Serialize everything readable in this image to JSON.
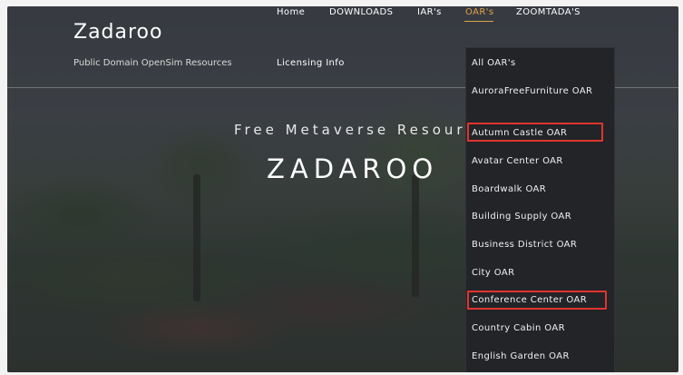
{
  "site": {
    "logo": "Zadaroo",
    "tagline": "Public Domain OpenSim Resources"
  },
  "nav": {
    "items": [
      "Home",
      "DOWNLOADS",
      "IAR's",
      "OAR's",
      "ZOOMTADA'S"
    ],
    "active": "OAR's",
    "second_row": "Licensing Info"
  },
  "hero": {
    "subtitle": "Free Metaverse Resources",
    "title": "ZADAROO"
  },
  "dropdown": {
    "items": [
      "All OAR's",
      "AuroraFreeFurniture OAR",
      "Autumn Castle OAR",
      "Avatar Center OAR",
      "Boardwalk OAR",
      "Building Supply OAR",
      "Business District OAR",
      "City OAR",
      "Conference Center OAR",
      "Country Cabin OAR",
      "English Garden OAR"
    ],
    "highlighted": [
      "Autumn Castle OAR",
      "Conference Center OAR"
    ]
  },
  "colors": {
    "accent": "#e0a24a",
    "highlight_box": "#e0342e",
    "dropdown_bg": "#222427"
  }
}
